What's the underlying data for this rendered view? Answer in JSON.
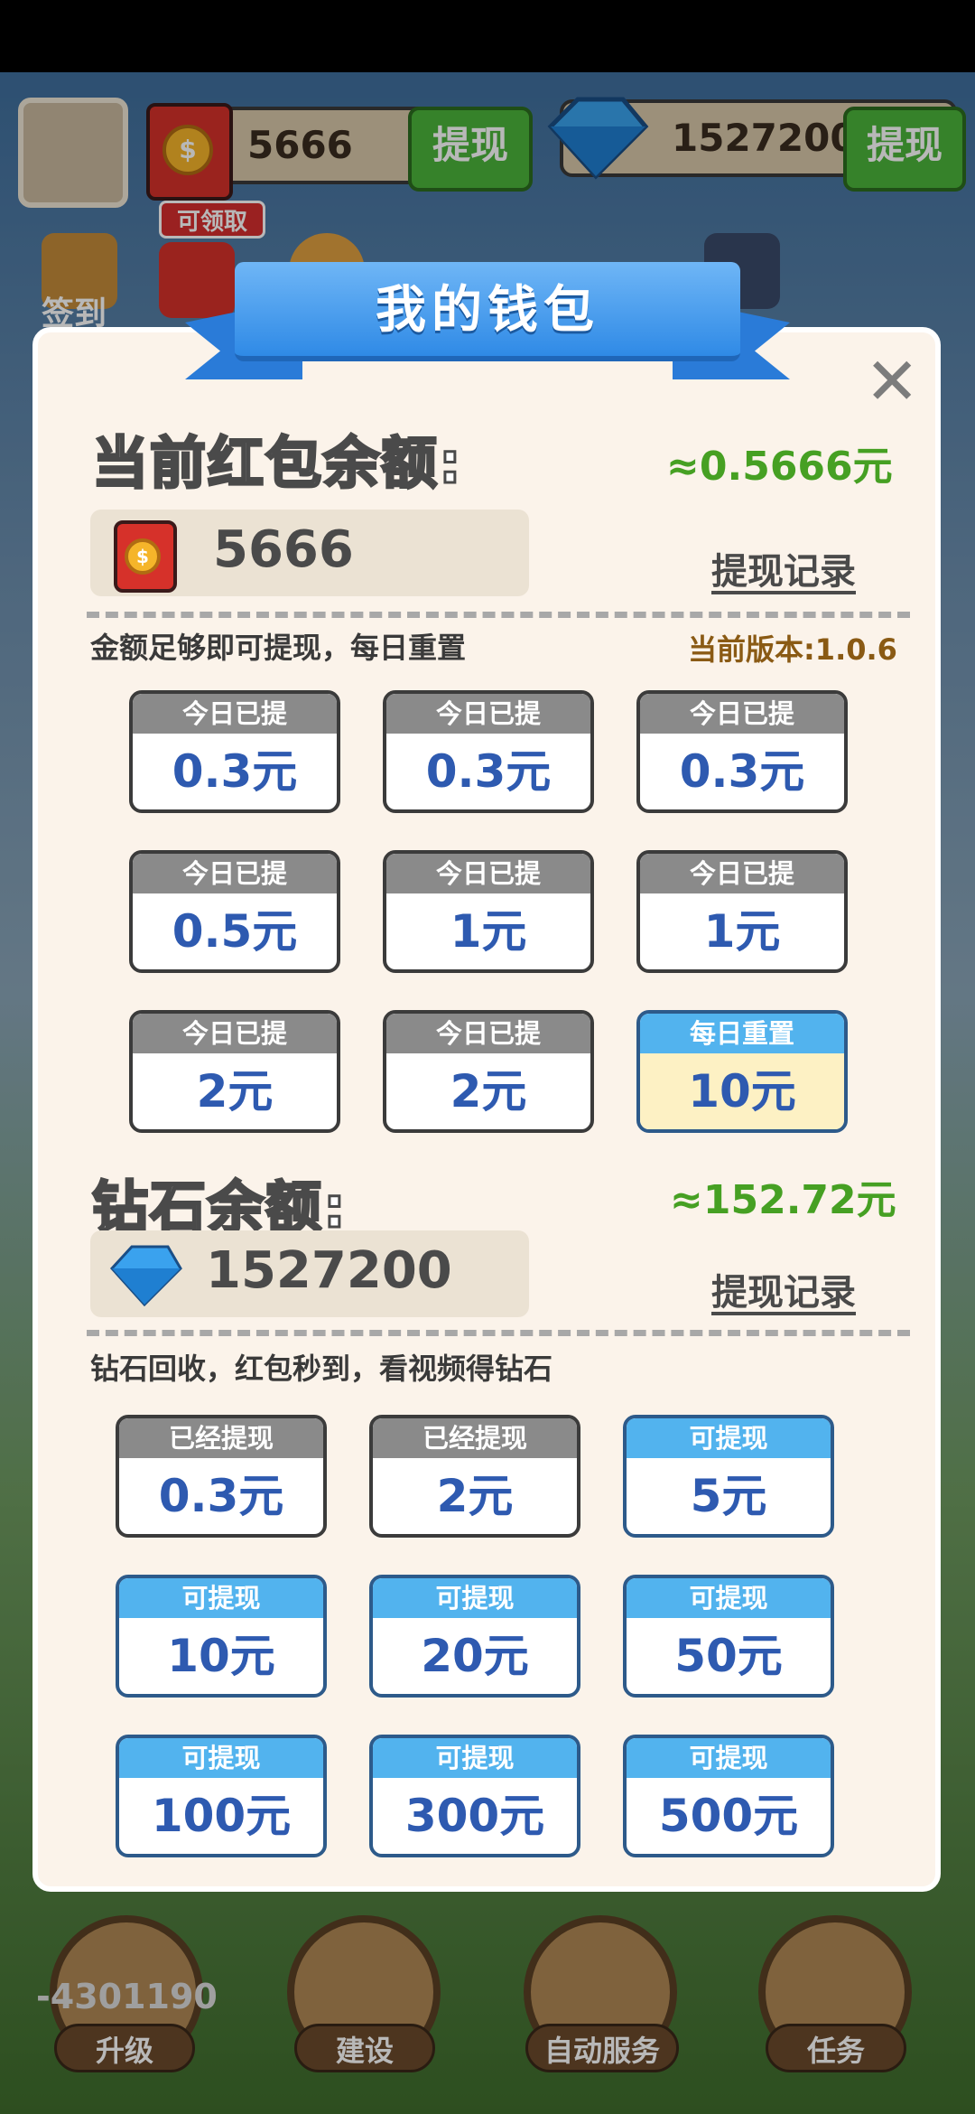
{
  "hud": {
    "coin_balance": "5666",
    "coin_withdraw_label": "提现",
    "gem_balance": "1527200",
    "gem_withdraw_label": "提现",
    "claim_tag": "可领取",
    "checkin_label": "签到"
  },
  "dialog": {
    "title": "我的钱包",
    "redpacket": {
      "heading": "当前红包余额:",
      "approx": "≈0.5666元",
      "balance": "5666",
      "record_link": "提现记录",
      "note": "金额足够即可提现，每日重置",
      "version": "当前版本:1.0.6",
      "tiles": [
        {
          "status": "今日已提",
          "amount": "0.3元"
        },
        {
          "status": "今日已提",
          "amount": "0.3元"
        },
        {
          "status": "今日已提",
          "amount": "0.3元"
        },
        {
          "status": "今日已提",
          "amount": "0.5元"
        },
        {
          "status": "今日已提",
          "amount": "1元"
        },
        {
          "status": "今日已提",
          "amount": "1元"
        },
        {
          "status": "今日已提",
          "amount": "2元"
        },
        {
          "status": "今日已提",
          "amount": "2元"
        },
        {
          "status": "每日重置",
          "amount": "10元"
        }
      ]
    },
    "diamond": {
      "heading": "钻石余额:",
      "approx": "≈152.72元",
      "balance": "1527200",
      "record_link": "提现记录",
      "note": "钻石回收，红包秒到，看视频得钻石",
      "tiles": [
        {
          "status": "已经提现",
          "amount": "0.3元"
        },
        {
          "status": "已经提现",
          "amount": "2元"
        },
        {
          "status": "可提现",
          "amount": "5元"
        },
        {
          "status": "可提现",
          "amount": "10元"
        },
        {
          "status": "可提现",
          "amount": "20元"
        },
        {
          "status": "可提现",
          "amount": "50元"
        },
        {
          "status": "可提现",
          "amount": "100元"
        },
        {
          "status": "可提现",
          "amount": "300元"
        },
        {
          "status": "可提现",
          "amount": "500元"
        }
      ]
    }
  },
  "bottom_nav": {
    "coins": "-4301190",
    "items": [
      {
        "label": "升级"
      },
      {
        "label": "建设"
      },
      {
        "label": "自动服务"
      },
      {
        "label": "任务"
      }
    ]
  },
  "colors": {
    "ribbon": "#2f8ae6",
    "approx_green": "#46a023",
    "amount_blue": "#2e5ab0",
    "tile_head_grey": "#8a8a8a",
    "tile_head_blue": "#52b3ee"
  }
}
